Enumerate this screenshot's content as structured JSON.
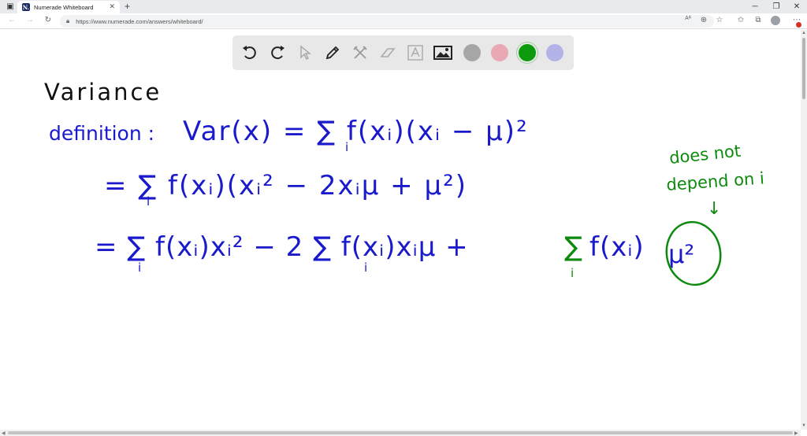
{
  "browser": {
    "tab_title": "Numerade Whiteboard",
    "favicon_text": "N.",
    "url": "https://www.numerade.com/answers/whiteboard/"
  },
  "toolbar": {
    "tools": [
      "undo-icon",
      "redo-icon",
      "pointer-icon",
      "pen-icon",
      "tools-icon",
      "eraser-icon",
      "text-icon",
      "image-icon"
    ],
    "colors": [
      "#a6a6a6",
      "#e8a8b4",
      "#0d9b0d",
      "#b3b3e8"
    ],
    "selected_color": "#0d9b0d"
  },
  "whiteboard": {
    "ink_colors": {
      "black": "#111111",
      "blue": "#1a1acc",
      "green": "#0d8a0d"
    },
    "title": "Variance",
    "definition_label": "definition :",
    "line1": "Var(x) = ∑ f(xᵢ)(xᵢ − μ)²",
    "line1_sub": "i",
    "line2": "= ∑ f(xᵢ)(xᵢ² − 2xᵢμ + μ²)",
    "line2_sub": "i",
    "line3_a": "= ∑ f(xᵢ)xᵢ² − 2 ∑ f(xᵢ)xᵢμ +",
    "line3_a_subs": [
      "i",
      "i"
    ],
    "line3_b": "∑",
    "line3_b_sub": "i",
    "line3_c": "f(xᵢ)",
    "line3_mu": "μ²",
    "note_line1": "does not",
    "note_line2": "depend on i",
    "note_arrow": "↓"
  }
}
